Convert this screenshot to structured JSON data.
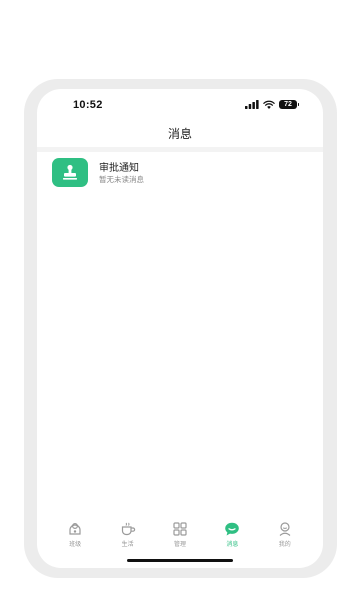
{
  "status_bar": {
    "time": "10:52",
    "battery": "72",
    "icons": [
      "signal-icon",
      "wifi-icon",
      "battery-icon"
    ]
  },
  "header": {
    "title": "消息"
  },
  "messages": [
    {
      "title": "审批通知",
      "subtitle": "暂无未读消息",
      "icon": "stamp-icon",
      "icon_color": "#2fbf83"
    }
  ],
  "tabs": [
    {
      "label": "班级",
      "icon": "class-icon",
      "active": false
    },
    {
      "label": "生活",
      "icon": "cup-icon",
      "active": false
    },
    {
      "label": "管理",
      "icon": "grid-icon",
      "active": false
    },
    {
      "label": "消息",
      "icon": "message-icon",
      "active": true
    },
    {
      "label": "我的",
      "icon": "profile-icon",
      "active": false
    }
  ],
  "colors": {
    "accent": "#2fbf83",
    "inactive": "#9a9a9a",
    "frame": "#ececec"
  }
}
